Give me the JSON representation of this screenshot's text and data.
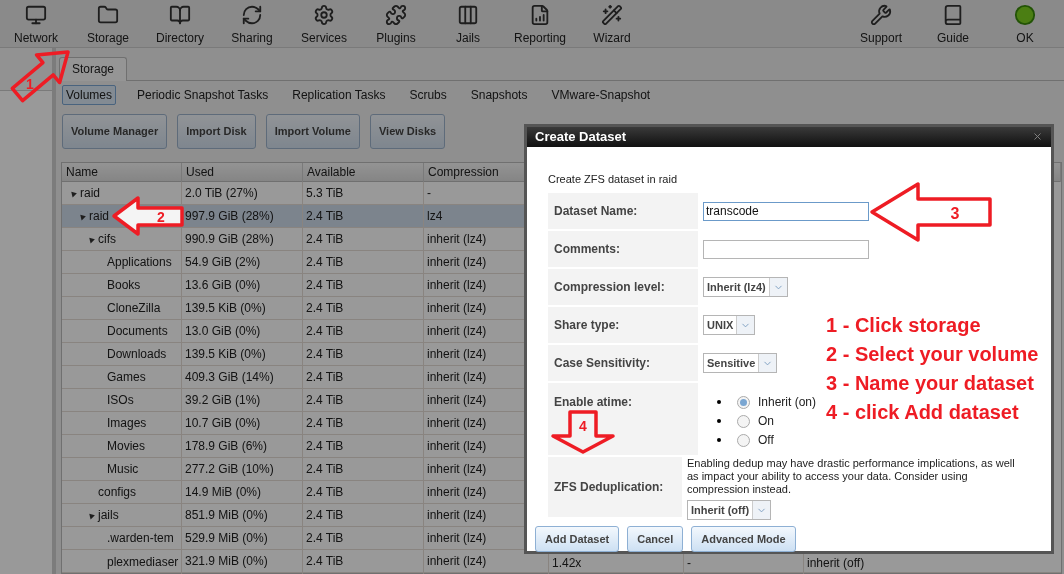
{
  "toolbar": {
    "left": [
      {
        "label": "Network"
      },
      {
        "label": "Storage"
      },
      {
        "label": "Directory"
      },
      {
        "label": "Sharing"
      },
      {
        "label": "Services"
      },
      {
        "label": "Plugins"
      },
      {
        "label": "Jails"
      },
      {
        "label": "Reporting"
      },
      {
        "label": "Wizard"
      }
    ],
    "right": [
      {
        "label": "Support"
      },
      {
        "label": "Guide"
      },
      {
        "label": "OK"
      }
    ]
  },
  "tab": {
    "label": "Storage"
  },
  "subtabs": [
    {
      "label": "Volumes",
      "selected": true
    },
    {
      "label": "Periodic Snapshot Tasks",
      "selected": false
    },
    {
      "label": "Replication Tasks",
      "selected": false
    },
    {
      "label": "Scrubs",
      "selected": false
    },
    {
      "label": "Snapshots",
      "selected": false
    },
    {
      "label": "VMware-Snapshot",
      "selected": false
    }
  ],
  "actions": [
    "Volume Manager",
    "Import Disk",
    "Import Volume",
    "View Disks"
  ],
  "table": {
    "columns": [
      "Name",
      "Used",
      "Available",
      "Compression"
    ],
    "rows": [
      {
        "name": "raid",
        "used": "2.0 TiB (27%)",
        "available": "5.3 TiB",
        "compression": "-",
        "selected": false,
        "expanded": true,
        "children": [
          {
            "name": "raid",
            "used": "997.9 GiB (28%)",
            "available": "2.4 TiB",
            "compression": "lz4",
            "selected": true,
            "expanded": true,
            "children": [
              {
                "name": "cifs",
                "used": "990.9 GiB (28%)",
                "available": "2.4 TiB",
                "compression": "inherit (lz4)",
                "selected": false,
                "expanded": true,
                "children": [
                  {
                    "name": "Applications",
                    "used": "54.9 GiB (2%)",
                    "available": "2.4 TiB",
                    "compression": "inherit (lz4)",
                    "selected": false
                  },
                  {
                    "name": "Books",
                    "used": "13.6 GiB (0%)",
                    "available": "2.4 TiB",
                    "compression": "inherit (lz4)",
                    "selected": false
                  },
                  {
                    "name": "CloneZilla",
                    "used": "139.5 KiB (0%)",
                    "available": "2.4 TiB",
                    "compression": "inherit (lz4)",
                    "selected": false
                  },
                  {
                    "name": "Documents",
                    "used": "13.0 GiB (0%)",
                    "available": "2.4 TiB",
                    "compression": "inherit (lz4)",
                    "selected": false
                  },
                  {
                    "name": "Downloads",
                    "used": "139.5 KiB (0%)",
                    "available": "2.4 TiB",
                    "compression": "inherit (lz4)",
                    "selected": false
                  },
                  {
                    "name": "Games",
                    "used": "409.3 GiB (14%)",
                    "available": "2.4 TiB",
                    "compression": "inherit (lz4)",
                    "selected": false
                  },
                  {
                    "name": "ISOs",
                    "used": "39.2 GiB (1%)",
                    "available": "2.4 TiB",
                    "compression": "inherit (lz4)",
                    "selected": false
                  },
                  {
                    "name": "Images",
                    "used": "10.7 GiB (0%)",
                    "available": "2.4 TiB",
                    "compression": "inherit (lz4)",
                    "selected": false
                  },
                  {
                    "name": "Movies",
                    "used": "178.9 GiB (6%)",
                    "available": "2.4 TiB",
                    "compression": "inherit (lz4)",
                    "selected": false
                  },
                  {
                    "name": "Music",
                    "used": "277.2 GiB (10%)",
                    "available": "2.4 TiB",
                    "compression": "inherit (lz4)",
                    "selected": false
                  }
                ]
              },
              {
                "name": "configs",
                "used": "14.9 MiB (0%)",
                "available": "2.4 TiB",
                "compression": "inherit (lz4)",
                "selected": false
              },
              {
                "name": "jails",
                "used": "851.9 MiB (0%)",
                "available": "2.4 TiB",
                "compression": "inherit (lz4)",
                "selected": false,
                "expanded": true,
                "children": [
                  {
                    "name": ".warden-tem",
                    "used": "529.9 MiB (0%)",
                    "available": "2.4 TiB",
                    "compression": "inherit (lz4)",
                    "selected": false
                  },
                  {
                    "name": "plexmediaser",
                    "used": "321.9 MiB (0%)",
                    "available": "2.4 TiB",
                    "compression": "inherit (lz4)",
                    "selected": false,
                    "column_5": "1.42x",
                    "column_6": "-",
                    "column_7": "inherit (off)"
                  }
                ]
              }
            ]
          }
        ]
      }
    ]
  },
  "dialog": {
    "title": "Create Dataset",
    "intro": "Create ZFS dataset in raid",
    "fields": [
      {
        "kind": "text",
        "label": "Dataset Name:",
        "value": "transcode",
        "focused": true
      },
      {
        "kind": "text",
        "label": "Comments:",
        "focused": false
      },
      {
        "kind": "select",
        "label": "Compression level:",
        "value": "Inherit (lz4)"
      },
      {
        "kind": "select",
        "label": "Share type:",
        "value": "UNIX"
      },
      {
        "kind": "select",
        "label": "Case Sensitivity:",
        "value": "Sensitive"
      },
      {
        "kind": "radio",
        "label": "Enable atime:",
        "options": [
          {
            "label": "Inherit (on)",
            "selected": true
          },
          {
            "label": "On",
            "selected": false
          },
          {
            "label": "Off",
            "selected": false
          }
        ]
      },
      {
        "kind": "select",
        "label": "ZFS Deduplication:",
        "note": "Enabling dedup may have drastic performance implications, as well as impact your ability to access your data. Consider using compression instead.",
        "value": "Inherit (off)"
      }
    ],
    "buttons": [
      "Add Dataset",
      "Cancel",
      "Advanced Mode"
    ]
  },
  "annotations": {
    "arrows": [
      {
        "number": "1"
      },
      {
        "number": "2"
      },
      {
        "number": "3"
      },
      {
        "number": "4"
      }
    ],
    "steps": [
      "1 - Click storage",
      "2 - Select your volume",
      "3 - Name your dataset",
      "4 - click Add dataset"
    ]
  }
}
